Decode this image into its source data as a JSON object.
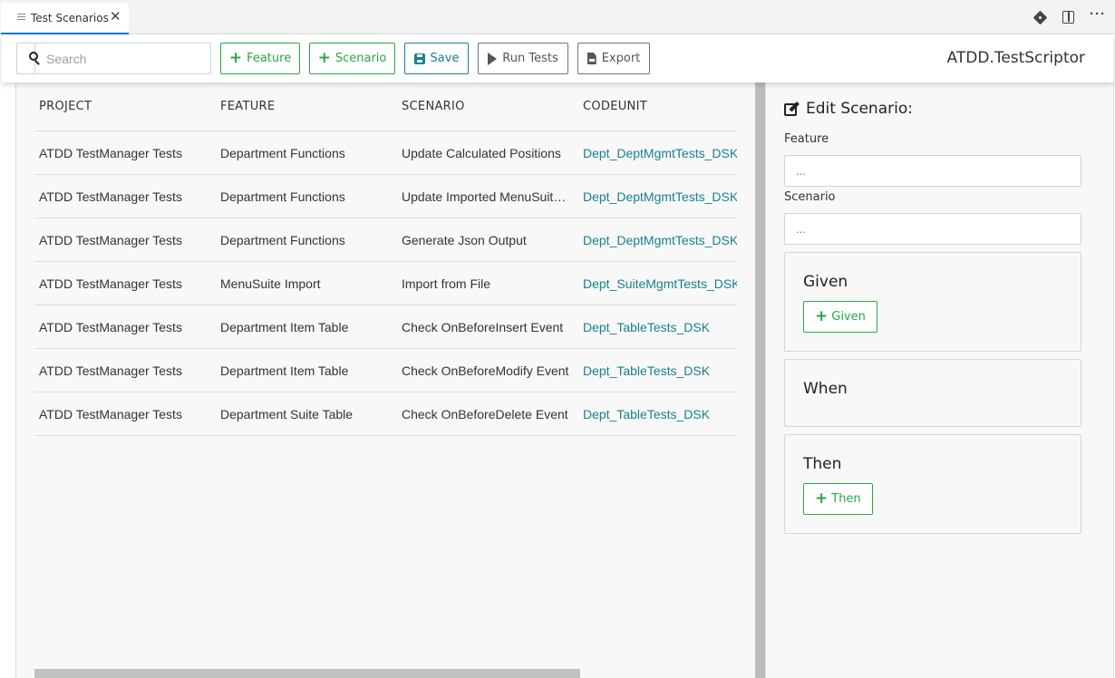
{
  "tab": {
    "label": "Test Scenarios",
    "close": "✕"
  },
  "tab_actions": {
    "more": "···"
  },
  "toolbar": {
    "search_placeholder": "Search",
    "feature_label": "Feature",
    "scenario_label": "Scenario",
    "save_label": "Save",
    "run_label": "Run Tests",
    "export_label": "Export",
    "app_title": "ATDD.TestScriptor"
  },
  "grid": {
    "headers": [
      "PROJECT",
      "FEATURE",
      "SCENARIO",
      "CODEUNIT"
    ],
    "rows": [
      [
        "ATDD TestManager Tests",
        "Department Functions",
        "Update Calculated Positions",
        "Dept_DeptMgmtTests_DSK"
      ],
      [
        "ATDD TestManager Tests",
        "Department Functions",
        "Update Imported MenuSuite Positions",
        "Dept_DeptMgmtTests_DSK"
      ],
      [
        "ATDD TestManager Tests",
        "Department Functions",
        "Generate Json Output",
        "Dept_DeptMgmtTests_DSK"
      ],
      [
        "ATDD TestManager Tests",
        "MenuSuite Import",
        "Import from File",
        "Dept_SuiteMgmtTests_DSK"
      ],
      [
        "ATDD TestManager Tests",
        "Department Item Table",
        "Check OnBeforeInsert Event",
        "Dept_TableTests_DSK"
      ],
      [
        "ATDD TestManager Tests",
        "Department Item Table",
        "Check OnBeforeModify Event",
        "Dept_TableTests_DSK"
      ],
      [
        "ATDD TestManager Tests",
        "Department Suite Table",
        "Check OnBeforeDelete Event",
        "Dept_TableTests_DSK"
      ]
    ]
  },
  "editor": {
    "title": "Edit Scenario:",
    "feature_label": "Feature",
    "feature_value": "...",
    "scenario_label": "Scenario",
    "scenario_value": "...",
    "given_title": "Given",
    "given_button": "Given",
    "when_title": "When",
    "then_title": "Then",
    "then_button": "Then"
  },
  "colors": {
    "accent_blue": "#0078d4",
    "green": "#28a745",
    "teal": "#17818f"
  }
}
